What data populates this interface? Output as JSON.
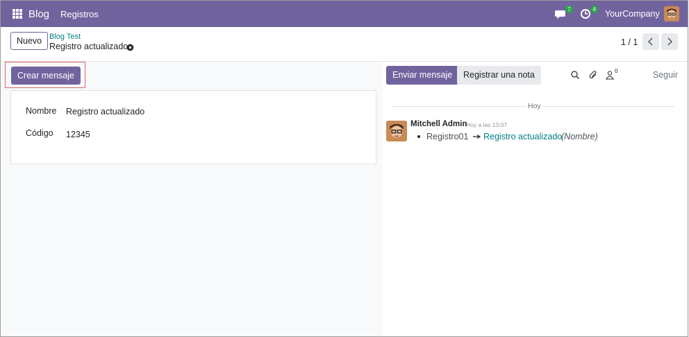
{
  "navbar": {
    "app_name": "Blog",
    "menu_item": "Registros",
    "messages_count": "7",
    "activities_count": "4",
    "company": "YourCompany",
    "icons": [
      "apps-grid-icon",
      "messages-icon",
      "activity-clock-icon",
      "user-avatar"
    ]
  },
  "control_panel": {
    "new_button": "Nuevo",
    "breadcrumb_parent": "Blog Test",
    "record_title": "Registro actualizado",
    "pager": "1 / 1"
  },
  "form": {
    "header_button": "Crear mensaje",
    "fields": [
      {
        "label": "Nombre",
        "value": "Registro actualizado"
      },
      {
        "label": "Código",
        "value": "12345"
      }
    ]
  },
  "chatter": {
    "send_message": "Enviar mensaje",
    "log_note": "Registrar una nota",
    "followers_count": "0",
    "follow": "Seguir",
    "date_separator": "Hoy",
    "message": {
      "author": "Mitchell Admin",
      "date": "Hoy a las 13:07",
      "old_value": "Registro01",
      "new_value": "Registro actualizado",
      "field": "(Nombre)"
    }
  },
  "colors": {
    "brand": "#71639e",
    "link": "#017e84",
    "badge": "#28a745",
    "highlight": "#e06468"
  }
}
